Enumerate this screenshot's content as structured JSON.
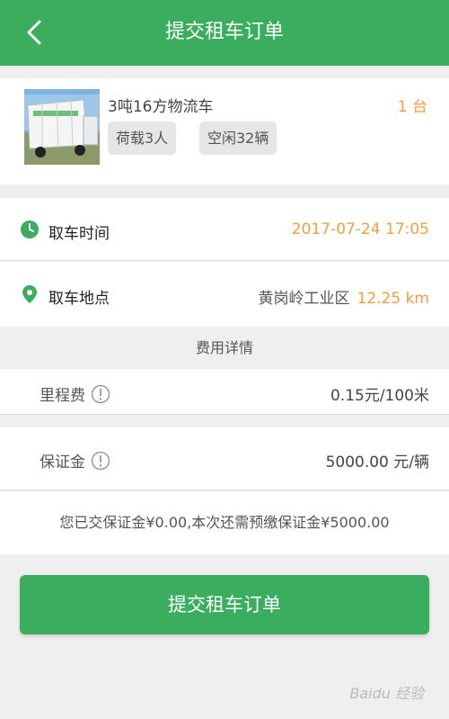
{
  "header": {
    "title": "提交租车订单",
    "back_icon": "chevron-left-icon"
  },
  "vehicle": {
    "name": "3吨16方物流车",
    "quantity": "1 台",
    "tags": [
      "荷载3人",
      "空闲32辆"
    ]
  },
  "pickup": {
    "time_label": "取车时间",
    "time_value": "2017-07-24 17:05",
    "place_label": "取车地点",
    "place_value": "黄岗岭工业区",
    "distance": "12.25 km"
  },
  "fees": {
    "section_title": "费用详情",
    "mileage_label": "里程费",
    "mileage_value": "0.15元/100米",
    "deposit_label": "保证金",
    "deposit_value": "5000.00 元/辆",
    "note": "您已交保证金¥0.00,本次还需预缴保证金¥5000.00"
  },
  "submit_label": "提交租车订单",
  "watermark": "Baidu 经验",
  "colors": {
    "brand": "#3aad5f",
    "accent": "#f0a040"
  }
}
